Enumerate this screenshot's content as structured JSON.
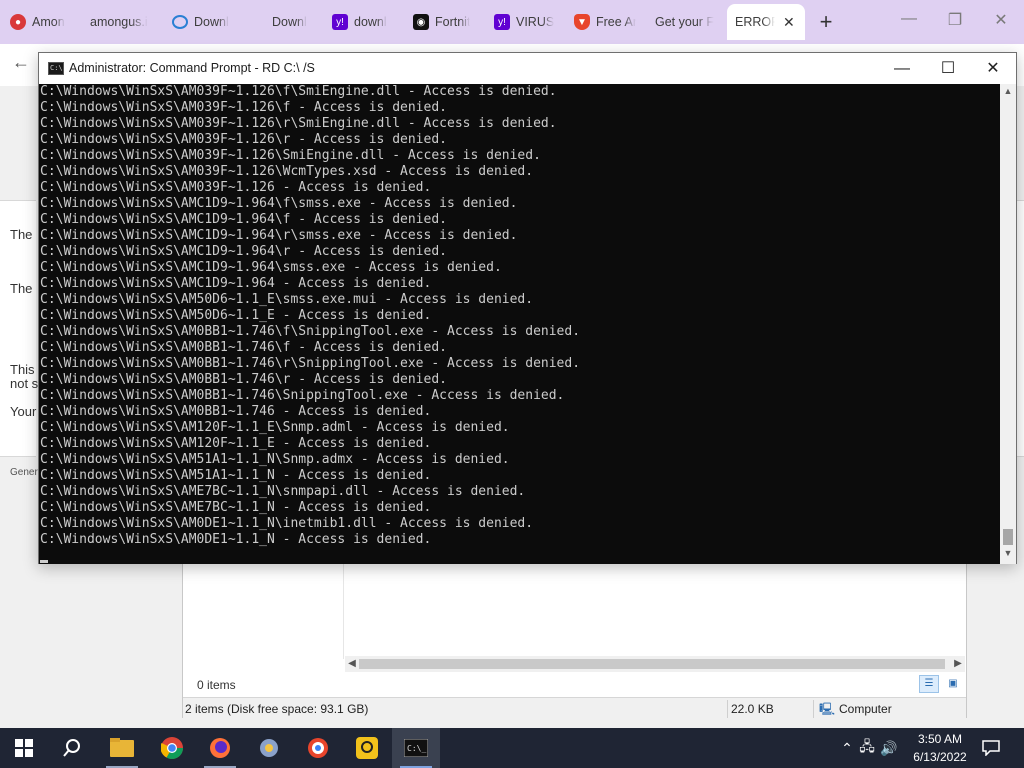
{
  "browser": {
    "tabs": [
      {
        "label": "Amon",
        "icon": "amongus-icon"
      },
      {
        "label": "amongus.i",
        "icon": "blank-icon"
      },
      {
        "label": "Downl",
        "icon": "edge-loading-icon"
      },
      {
        "label": "Downl",
        "icon": "blank-icon"
      },
      {
        "label": "downl",
        "icon": "yahoo-icon"
      },
      {
        "label": "Fortnit",
        "icon": "fortnite-icon"
      },
      {
        "label": "VIRUS",
        "icon": "yahoo-icon"
      },
      {
        "label": "Free Ar",
        "icon": "brave-icon"
      },
      {
        "label": "Get your F",
        "icon": "blank-icon"
      },
      {
        "label": "ERROR:",
        "icon": "blank-icon"
      }
    ],
    "tab_strip_color": "#dfd0f2"
  },
  "webpage": {
    "text_lines": [
      "The",
      "The",
      "This",
      "not s",
      "Your",
      "Gener"
    ]
  },
  "explorer": {
    "items_count": "0 items",
    "status_items": "2 items (Disk free space: 93.1 GB)",
    "status_size": "22.0 KB",
    "status_location": "Computer"
  },
  "cmd": {
    "title": "Administrator: Command Prompt - RD  C:\\ /S",
    "lines": [
      "C:\\Windows\\WinSxS\\AM039F~1.126\\f\\SmiEngine.dll - Access is denied.",
      "C:\\Windows\\WinSxS\\AM039F~1.126\\f - Access is denied.",
      "C:\\Windows\\WinSxS\\AM039F~1.126\\r\\SmiEngine.dll - Access is denied.",
      "C:\\Windows\\WinSxS\\AM039F~1.126\\r - Access is denied.",
      "C:\\Windows\\WinSxS\\AM039F~1.126\\SmiEngine.dll - Access is denied.",
      "C:\\Windows\\WinSxS\\AM039F~1.126\\WcmTypes.xsd - Access is denied.",
      "C:\\Windows\\WinSxS\\AM039F~1.126 - Access is denied.",
      "C:\\Windows\\WinSxS\\AMC1D9~1.964\\f\\smss.exe - Access is denied.",
      "C:\\Windows\\WinSxS\\AMC1D9~1.964\\f - Access is denied.",
      "C:\\Windows\\WinSxS\\AMC1D9~1.964\\r\\smss.exe - Access is denied.",
      "C:\\Windows\\WinSxS\\AMC1D9~1.964\\r - Access is denied.",
      "C:\\Windows\\WinSxS\\AMC1D9~1.964\\smss.exe - Access is denied.",
      "C:\\Windows\\WinSxS\\AMC1D9~1.964 - Access is denied.",
      "C:\\Windows\\WinSxS\\AM50D6~1.1_E\\smss.exe.mui - Access is denied.",
      "C:\\Windows\\WinSxS\\AM50D6~1.1_E - Access is denied.",
      "C:\\Windows\\WinSxS\\AM0BB1~1.746\\f\\SnippingTool.exe - Access is denied.",
      "C:\\Windows\\WinSxS\\AM0BB1~1.746\\f - Access is denied.",
      "C:\\Windows\\WinSxS\\AM0BB1~1.746\\r\\SnippingTool.exe - Access is denied.",
      "C:\\Windows\\WinSxS\\AM0BB1~1.746\\r - Access is denied.",
      "C:\\Windows\\WinSxS\\AM0BB1~1.746\\SnippingTool.exe - Access is denied.",
      "C:\\Windows\\WinSxS\\AM0BB1~1.746 - Access is denied.",
      "C:\\Windows\\WinSxS\\AM120F~1.1_E\\Snmp.adml - Access is denied.",
      "C:\\Windows\\WinSxS\\AM120F~1.1_E - Access is denied.",
      "C:\\Windows\\WinSxS\\AM51A1~1.1_N\\Snmp.admx - Access is denied.",
      "C:\\Windows\\WinSxS\\AM51A1~1.1_N - Access is denied.",
      "C:\\Windows\\WinSxS\\AME7BC~1.1_N\\snmpapi.dll - Access is denied.",
      "C:\\Windows\\WinSxS\\AME7BC~1.1_N - Access is denied.",
      "C:\\Windows\\WinSxS\\AM0DE1~1.1_N\\inetmib1.dll - Access is denied.",
      "C:\\Windows\\WinSxS\\AM0DE1~1.1_N - Access is denied."
    ]
  },
  "taskbar": {
    "apps": [
      "start-icon",
      "search-icon",
      "file-explorer-icon",
      "chrome-icon",
      "firefox-icon",
      "app-icon",
      "brave-icon",
      "app-icon",
      "command-prompt-icon"
    ],
    "time": "3:50 AM",
    "date": "6/13/2022",
    "color": "#1f2534"
  }
}
